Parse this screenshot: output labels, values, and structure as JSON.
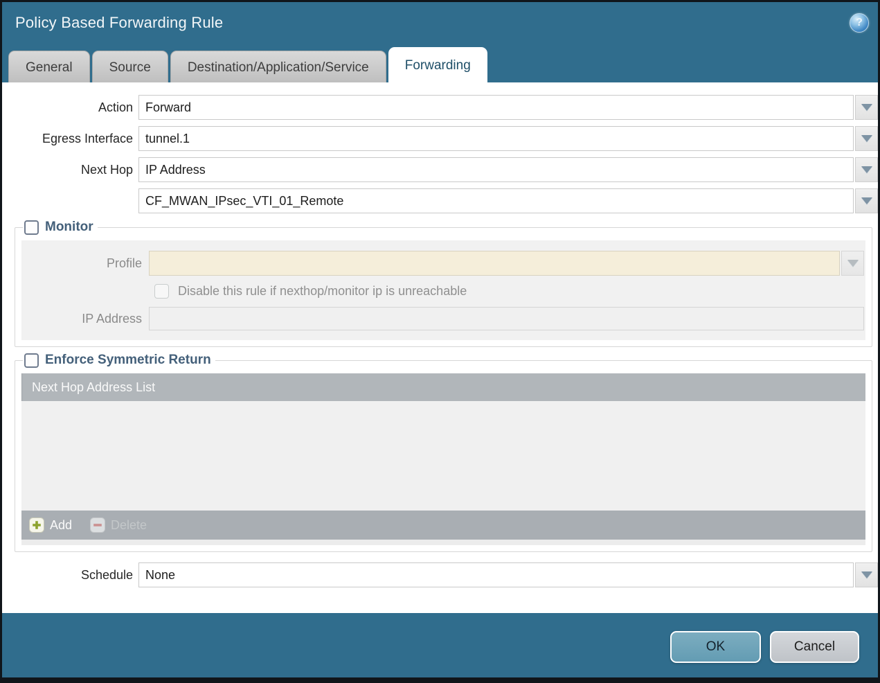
{
  "window": {
    "title": "Policy Based Forwarding Rule",
    "help_glyph": "?"
  },
  "tabs": [
    {
      "label": "General",
      "active": false
    },
    {
      "label": "Source",
      "active": false
    },
    {
      "label": "Destination/Application/Service",
      "active": false
    },
    {
      "label": "Forwarding",
      "active": true
    }
  ],
  "form": {
    "action": {
      "label": "Action",
      "value": "Forward"
    },
    "egress_interface": {
      "label": "Egress Interface",
      "value": "tunnel.1"
    },
    "next_hop": {
      "label": "Next Hop",
      "value": "IP Address"
    },
    "next_hop_address": {
      "value": "CF_MWAN_IPsec_VTI_01_Remote"
    },
    "schedule": {
      "label": "Schedule",
      "value": "None"
    }
  },
  "monitor": {
    "label": "Monitor",
    "checked": false,
    "profile": {
      "label": "Profile",
      "value": ""
    },
    "disable_rule_checkbox": {
      "label": "Disable this rule if nexthop/monitor ip is unreachable",
      "checked": false
    },
    "ip_address": {
      "label": "IP Address",
      "value": ""
    }
  },
  "enforce_symmetric_return": {
    "label": "Enforce Symmetric Return",
    "checked": false,
    "table": {
      "header": "Next Hop Address List",
      "rows": []
    },
    "add_label": "Add",
    "delete_label": "Delete",
    "delete_enabled": false
  },
  "footer": {
    "ok_label": "OK",
    "cancel_label": "Cancel"
  },
  "colors": {
    "frame_teal": "#306d8d",
    "ok_button": "#6fa6ba",
    "cancel_button": "#c9cdd2",
    "profile_disabled_bg": "#f5eeda",
    "table_header_bg": "#b1b6ba",
    "table_footer_bg": "#a9aeb3",
    "add_plus_green": "#8da32f",
    "delete_minus_red": "#cb9191",
    "legend_text": "#44607a"
  }
}
